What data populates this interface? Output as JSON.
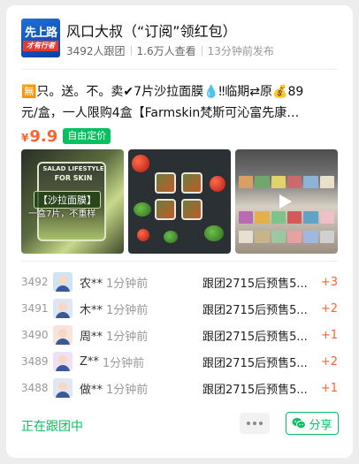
{
  "group": {
    "logo_text_top": "先上路",
    "logo_text_bottom": "才有行者",
    "title": "风口大叔（“订阅”领红包）",
    "followers": "3492人跟团",
    "views": "1.6万人查看",
    "time": "13分钟前发布"
  },
  "post": {
    "description_line1": "🈚只。送。不。卖✔7片沙拉面膜💧‼临期⇄原💰89",
    "description_line2": "元/盒，一人限购4盒【Farmskin梵斯可沁富先康…",
    "currency": "¥",
    "price": "9.9",
    "price_tag": "自由定价"
  },
  "images": {
    "img1_label_top": "SALAD LIFESTYLE",
    "img1_label_main": "FOR SKIN",
    "img1_caption1": "【沙拉面膜】",
    "img1_caption2": "一盒7片，不重样",
    "has_video": true
  },
  "orders": [
    {
      "num": "3492",
      "name": "农**",
      "ago": "1分钟前",
      "item": "跟团2715后预售5...",
      "qty": "+3",
      "avatar_color": "#5b8fd6"
    },
    {
      "num": "3491",
      "name": "木**",
      "ago": "1分钟前",
      "item": "跟团2715后预售5...",
      "qty": "+2",
      "avatar_color": "#3e6fb0"
    },
    {
      "num": "3490",
      "name": "周**",
      "ago": "1分钟前",
      "item": "跟团2715后预售5...",
      "qty": "+1",
      "avatar_color": "#e09a7a"
    },
    {
      "num": "3489",
      "name": "Z**",
      "ago": "1分钟前",
      "item": "跟团2715后预售5...",
      "qty": "+2",
      "avatar_color": "#c58bd6"
    },
    {
      "num": "3488",
      "name": "做**",
      "ago": "1分钟前",
      "item": "跟团2715后预售5...",
      "qty": "+1",
      "avatar_color": "#7a88c9"
    }
  ],
  "footer": {
    "status": "正在跟团中",
    "share_label": "分享"
  },
  "colors": {
    "accent_green": "#07c160",
    "price_orange": "#fa6432"
  }
}
